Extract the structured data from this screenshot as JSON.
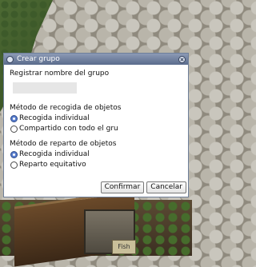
{
  "dialog": {
    "title": "Crear grupo",
    "name_label": "Registrar nombre del grupo",
    "name_value": "",
    "collect_label": "Método de recogida de objetos",
    "collect_options": [
      {
        "label": "Recogida individual",
        "checked": true
      },
      {
        "label": "Compartido con todo el gru",
        "checked": false
      }
    ],
    "distribute_label": "Método de reparto de objetos",
    "distribute_options": [
      {
        "label": "Recogida individual",
        "checked": true
      },
      {
        "label": "Reparto equitativo",
        "checked": false
      }
    ],
    "confirm_label": "Confirmar",
    "cancel_label": "Cancelar"
  },
  "background": {
    "sign_text": "Fish"
  },
  "colors": {
    "titlebar": "#5a6b8c",
    "radio_checked": "#5a7fd0"
  }
}
